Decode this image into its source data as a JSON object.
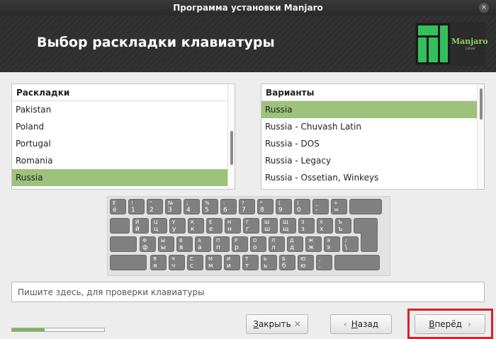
{
  "window": {
    "title": "Программа установки Manjaro",
    "close_symbol": "×"
  },
  "header": {
    "title": "Выбор раскладки клавиатуры",
    "logo_text": "Manjaro",
    "logo_sub": "Linux"
  },
  "layouts": {
    "header": "Раскладки",
    "items": [
      "Pakistan",
      "Poland",
      "Portugal",
      "Romania",
      "Russia"
    ],
    "selected": "Russia"
  },
  "variants": {
    "header": "Варианты",
    "items": [
      "Russia",
      "Russia - Chuvash Latin",
      "Russia - DOS",
      "Russia - Legacy",
      "Russia - Ossetian, Winkeys"
    ],
    "selected": "Russia"
  },
  "keyboard": {
    "rows": [
      [
        [
          "Ё",
          "ё"
        ],
        [
          "!",
          "1"
        ],
        [
          "\"",
          "2"
        ],
        [
          "№",
          "3"
        ],
        [
          ";",
          "4"
        ],
        [
          "%",
          "5"
        ],
        [
          ":",
          "6"
        ],
        [
          "?",
          "7"
        ],
        [
          "*",
          "8"
        ],
        [
          "(",
          "9"
        ],
        [
          ")",
          "0"
        ],
        [
          "_",
          "-"
        ],
        [
          "+",
          "="
        ]
      ],
      [
        [
          "Й",
          "й"
        ],
        [
          "Ц",
          "ц"
        ],
        [
          "У",
          "у"
        ],
        [
          "К",
          "к"
        ],
        [
          "Е",
          "е"
        ],
        [
          "Н",
          "н"
        ],
        [
          "Г",
          "г"
        ],
        [
          "Ш",
          "ш"
        ],
        [
          "Щ",
          "щ"
        ],
        [
          "З",
          "з"
        ],
        [
          "Х",
          "х"
        ],
        [
          "Ъ",
          "ъ"
        ]
      ],
      [
        [
          "Ф",
          "ф"
        ],
        [
          "Ы",
          "ы"
        ],
        [
          "В",
          "в"
        ],
        [
          "А",
          "а"
        ],
        [
          "П",
          "п"
        ],
        [
          "Р",
          "р"
        ],
        [
          "О",
          "о"
        ],
        [
          "Л",
          "л"
        ],
        [
          "Д",
          "д"
        ],
        [
          "Ж",
          "ж"
        ],
        [
          "Э",
          "э"
        ],
        [
          "/",
          "\\"
        ]
      ],
      [
        [
          "Я",
          "я"
        ],
        [
          "Ч",
          "ч"
        ],
        [
          "С",
          "с"
        ],
        [
          "М",
          "м"
        ],
        [
          "И",
          "и"
        ],
        [
          "Т",
          "т"
        ],
        [
          "Ь",
          "ь"
        ],
        [
          "Б",
          "б"
        ],
        [
          "Ю",
          "ю"
        ],
        [
          ",",
          "."
        ]
      ]
    ]
  },
  "test_input": {
    "placeholder": "Пишите здесь, для проверки клавиатуры",
    "value": ""
  },
  "progress": {
    "fraction": 0.35
  },
  "buttons": {
    "close": {
      "accel": "З",
      "rest": "акрыть",
      "symbol": "✕"
    },
    "back": {
      "accel": "Н",
      "rest": "азад",
      "symbol": "‹"
    },
    "next": {
      "accel": "В",
      "rest": "перёд",
      "symbol": "›"
    }
  },
  "colors": {
    "selection": "#9dc27c",
    "accent": "#8bd35a",
    "highlight_box": "#d2232a"
  }
}
